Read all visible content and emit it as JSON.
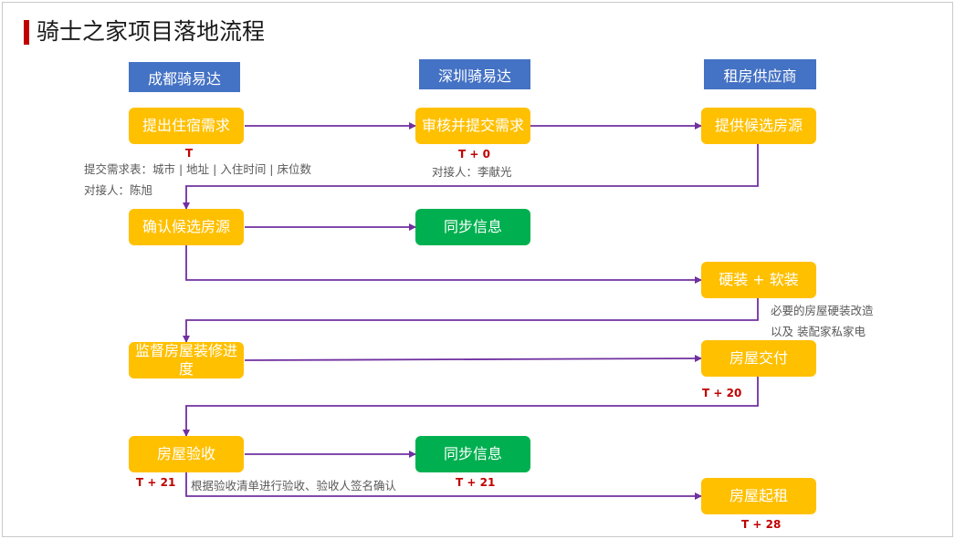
{
  "title": "骑士之家项目落地流程",
  "colors": {
    "heading_blue": "#4472c4",
    "step_yellow": "#ffc000",
    "step_green": "#00b050",
    "arrow_purple": "#7030a0",
    "timing_red": "#c00000",
    "title_accent": "#c00000"
  },
  "columns": {
    "chengdu": "成都骑易达",
    "shenzhen": "深圳骑易达",
    "supplier": "租房供应商"
  },
  "steps": {
    "submit_request": "提出住宿需求",
    "review_submit": "审核并提交需求",
    "provide_listings": "提供候选房源",
    "confirm_listings": "确认候选房源",
    "sync_info_1": "同步信息",
    "renovation": "硬装 + 软装",
    "supervise_progress": "监督房屋装修进度",
    "handover": "房屋交付",
    "acceptance": "房屋验收",
    "sync_info_2": "同步信息",
    "rent_start": "房屋起租"
  },
  "timings": {
    "submit_request": "T",
    "review_submit": "T + 0",
    "handover": "T + 20",
    "acceptance": "T + 21",
    "sync_info_2": "T + 21",
    "rent_start": "T + 28"
  },
  "notes": {
    "request_form": "提交需求表：城市 | 地址 | 入住时间 | 床位数",
    "chengdu_contact": "对接人：陈旭",
    "shenzhen_contact": "对接人：李献光",
    "renovation_line1": "必要的房屋硬装改造",
    "renovation_line2": "以及 装配家私家电",
    "acceptance_note": "根据验收清单进行验收、验收人签名确认"
  }
}
